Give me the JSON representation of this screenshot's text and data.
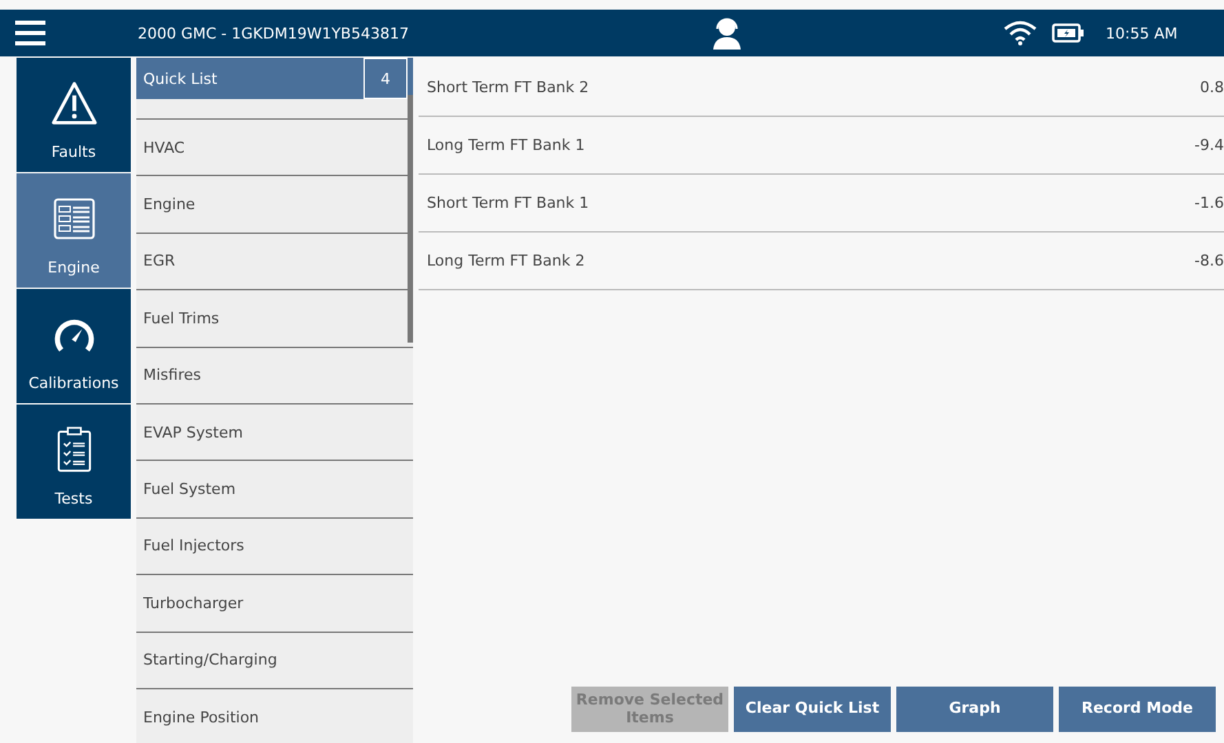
{
  "header": {
    "title": "2000 GMC - 1GKDM19W1YB543817",
    "time": "10:55 AM"
  },
  "nav": [
    {
      "label": "Faults",
      "kind": "warning",
      "selected": false
    },
    {
      "label": "Engine",
      "kind": "module",
      "selected": true
    },
    {
      "label": "Calibrations",
      "kind": "gauge",
      "selected": false
    },
    {
      "label": "Tests",
      "kind": "checklist",
      "selected": false
    }
  ],
  "quick_list": {
    "label": "Quick List",
    "count": "4"
  },
  "categories": [
    "HVAC",
    "Engine",
    "EGR",
    "Fuel Trims",
    "Misfires",
    "EVAP System",
    "Fuel System",
    "Fuel Injectors",
    "Turbocharger",
    "Starting/Charging",
    "Engine Position"
  ],
  "rows": [
    {
      "name": "Short Term FT Bank 2",
      "value": "0.8"
    },
    {
      "name": "Long Term FT Bank 1",
      "value": "-9.4"
    },
    {
      "name": "Short Term FT Bank 1",
      "value": "-1.6"
    },
    {
      "name": "Long Term FT Bank 2",
      "value": "-8.6"
    }
  ],
  "buttons": [
    {
      "label": "Remove Selected Items",
      "disabled": true
    },
    {
      "label": "Clear Quick List",
      "disabled": false
    },
    {
      "label": "Graph",
      "disabled": false
    },
    {
      "label": "Record Mode",
      "disabled": false
    }
  ]
}
